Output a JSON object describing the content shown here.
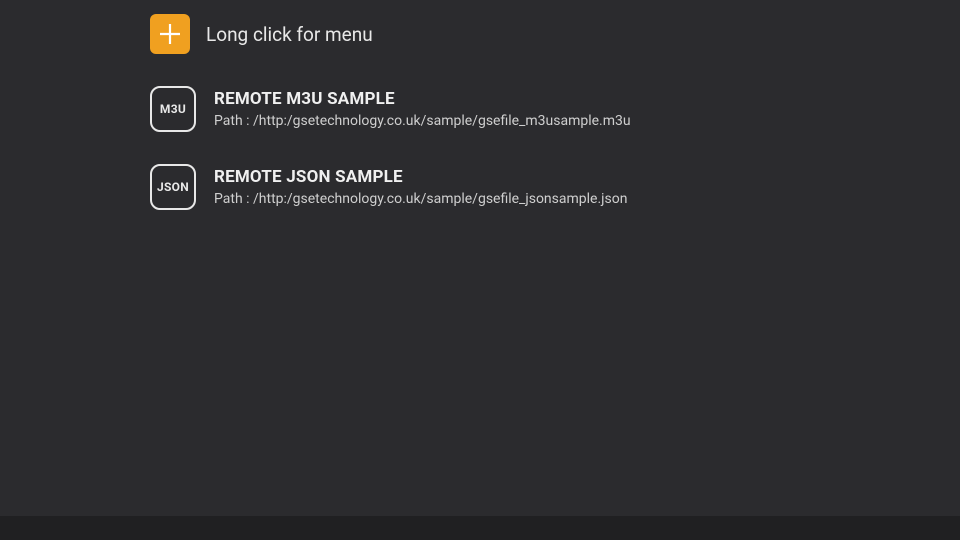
{
  "header": {
    "hint": "Long click for menu"
  },
  "playlists": [
    {
      "icon_label": "M3U",
      "title": "REMOTE M3U SAMPLE",
      "path_prefix": "Path : ",
      "path": "/http:/gsetechnology.co.uk/sample/gsefile_m3usample.m3u"
    },
    {
      "icon_label": "JSON",
      "title": "REMOTE JSON SAMPLE",
      "path_prefix": "Path : ",
      "path": "/http:/gsetechnology.co.uk/sample/gsefile_jsonsample.json"
    }
  ],
  "colors": {
    "accent": "#f0a020",
    "background": "#2b2b2e"
  }
}
